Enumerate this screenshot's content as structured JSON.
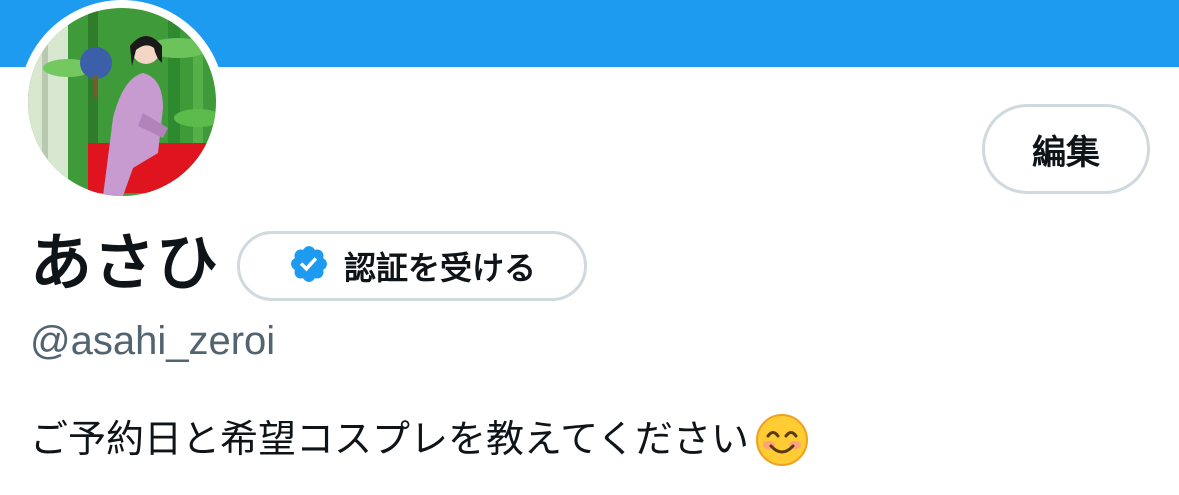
{
  "header": {
    "banner_color": "#1d9bf0"
  },
  "profile": {
    "avatar_icon": "profile-photo",
    "display_name": "あさひ",
    "handle": "@asahi_zeroi",
    "bio": "ご予約日と希望コスプレを教えてください",
    "bio_emoji_icon": "smiling-face-emoji"
  },
  "buttons": {
    "edit_label": "編集",
    "verify_label": "認証を受ける",
    "verify_icon": "verified-badge-icon"
  },
  "colors": {
    "accent": "#1d9bf0",
    "text_primary": "#0f1419",
    "text_secondary": "#536471",
    "border": "#cfd9de"
  }
}
